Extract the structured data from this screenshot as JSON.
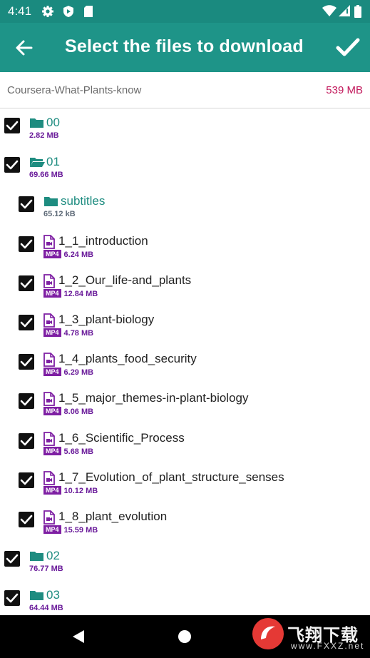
{
  "status_bar": {
    "time": "4:41",
    "icons": [
      "gear-icon",
      "shield-icon",
      "sd-card-icon",
      "wifi-icon",
      "signal-icon",
      "battery-icon"
    ]
  },
  "app_bar": {
    "title": "Select the files to download",
    "back_icon": "arrow-left-icon",
    "confirm_icon": "check-icon"
  },
  "course": {
    "name": "Coursera-What-Plants-know",
    "total_size": "539 MB"
  },
  "items": [
    {
      "kind": "folder",
      "open": false,
      "level": 0,
      "name": "00",
      "size": "2.82 MB",
      "checked": true
    },
    {
      "kind": "folder",
      "open": true,
      "level": 0,
      "name": "01",
      "size": "69.66 MB",
      "checked": true
    },
    {
      "kind": "folder",
      "open": false,
      "level": 1,
      "name": "subtitles",
      "size": "65.12 kB",
      "checked": true
    },
    {
      "kind": "file",
      "level": 1,
      "name": "1_1_introduction",
      "type": "MP4",
      "size": "6.24 MB",
      "checked": true
    },
    {
      "kind": "file",
      "level": 1,
      "name": "1_2_Our_life-and_plants",
      "type": "MP4",
      "size": "12.84 MB",
      "checked": true
    },
    {
      "kind": "file",
      "level": 1,
      "name": "1_3_plant-biology",
      "type": "MP4",
      "size": "4.78 MB",
      "checked": true
    },
    {
      "kind": "file",
      "level": 1,
      "name": "1_4_plants_food_security",
      "type": "MP4",
      "size": "6.29 MB",
      "checked": true
    },
    {
      "kind": "file",
      "level": 1,
      "name": "1_5_major_themes-in-plant-biology",
      "type": "MP4",
      "size": "8.06 MB",
      "checked": true
    },
    {
      "kind": "file",
      "level": 1,
      "name": "1_6_Scientific_Process",
      "type": "MP4",
      "size": "5.68 MB",
      "checked": true
    },
    {
      "kind": "file",
      "level": 1,
      "name": "1_7_Evolution_of_plant_structure_senses",
      "type": "MP4",
      "size": "10.12 MB",
      "checked": true
    },
    {
      "kind": "file",
      "level": 1,
      "name": "1_8_plant_evolution",
      "type": "MP4",
      "size": "15.59 MB",
      "checked": true
    },
    {
      "kind": "folder",
      "open": false,
      "level": 0,
      "name": "02",
      "size": "76.77 MB",
      "checked": true
    },
    {
      "kind": "folder",
      "open": false,
      "level": 0,
      "name": "03",
      "size": "64.44 MB",
      "checked": true
    }
  ],
  "nav_bar": {
    "icons": [
      "back-triangle-icon",
      "home-circle-icon"
    ]
  },
  "watermark": {
    "text": "飞翔下载",
    "sub": "www.FXXZ.net"
  },
  "colors": {
    "header": "#1e9488",
    "status_bar": "#1a8a7f",
    "accent_total": "#c2185b",
    "folder_text": "#1e8c80",
    "size_text": "#6a1b9a",
    "badge": "#7e1fa3"
  }
}
